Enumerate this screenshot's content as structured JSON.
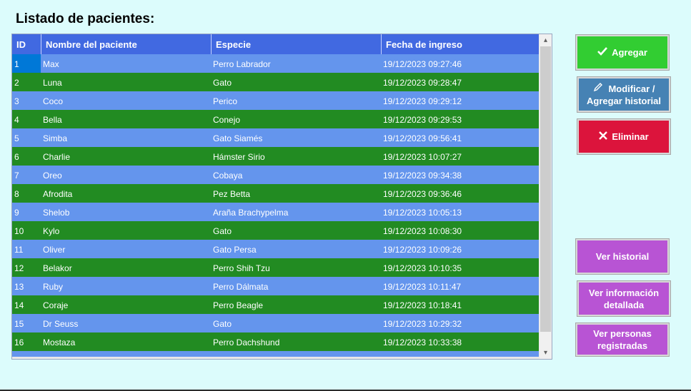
{
  "window": {
    "title": "Listado de pacientes:"
  },
  "table": {
    "columns": [
      "ID",
      "Nombre del paciente",
      "Especie",
      "Fecha de ingreso"
    ],
    "rows": [
      [
        "1",
        "Max",
        "Perro Labrador",
        "19/12/2023 09:27:46"
      ],
      [
        "2",
        "Luna",
        "Gato",
        "19/12/2023 09:28:47"
      ],
      [
        "3",
        "Coco",
        "Perico",
        "19/12/2023 09:29:12"
      ],
      [
        "4",
        "Bella",
        "Conejo",
        "19/12/2023 09:29:53"
      ],
      [
        "5",
        "Simba",
        "Gato Siamés",
        "19/12/2023 09:56:41"
      ],
      [
        "6",
        "Charlie",
        "Hámster Sirio",
        "19/12/2023 10:07:27"
      ],
      [
        "7",
        "Oreo",
        "Cobaya",
        "19/12/2023 09:34:38"
      ],
      [
        "8",
        "Afrodita",
        " Pez Betta",
        "19/12/2023 09:36:46"
      ],
      [
        "9",
        "Shelob",
        "Araña Brachypelma",
        "19/12/2023 10:05:13"
      ],
      [
        "10",
        "Kylo",
        "Gato",
        "19/12/2023 10:08:30"
      ],
      [
        "11",
        "Oliver",
        "Gato Persa",
        "19/12/2023 10:09:26"
      ],
      [
        "12",
        "Belakor",
        "Perro Shih Tzu",
        "19/12/2023 10:10:35"
      ],
      [
        "13",
        "Ruby",
        "Perro Dálmata",
        "19/12/2023 10:11:47"
      ],
      [
        "14",
        "Coraje",
        "Perro Beagle",
        "19/12/2023 10:18:41"
      ],
      [
        "15",
        "Dr Seuss",
        "Gato",
        "19/12/2023 10:29:32"
      ],
      [
        "16",
        "Mostaza",
        "Perro Dachshund",
        "19/12/2023 10:33:38"
      ]
    ]
  },
  "buttons": {
    "add": {
      "label": "Agregar",
      "icon": "check-icon",
      "color": "#32cd32"
    },
    "modify": {
      "label": "Modificar / Agregar historial",
      "icon": "pencil-icon",
      "color": "#4682b4"
    },
    "delete": {
      "label": "Eliminar",
      "icon": "close-icon",
      "color": "#dc143c"
    },
    "view_history": {
      "label": "Ver historial",
      "color": "#b854d4"
    },
    "view_details": {
      "label": "Ver información detallada",
      "color": "#b854d4"
    },
    "view_people": {
      "label": "Ver personas registradas",
      "color": "#b854d4"
    }
  },
  "colors": {
    "background": "#dcfcfc",
    "header": "#4169e1",
    "row_odd": "#6495ed",
    "row_even": "#228b22",
    "selection": "#0078d7"
  }
}
